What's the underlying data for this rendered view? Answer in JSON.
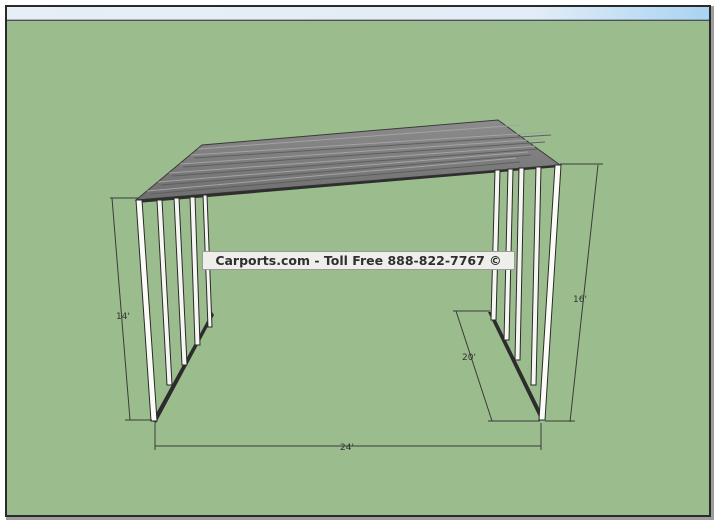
{
  "watermark": "Carports.com - Toll Free 888-822-7767 ©",
  "dimensions": {
    "height_left": "14'",
    "height_right": "16'",
    "depth": "20'",
    "width": "24'"
  },
  "colors": {
    "background": "#9bbd8e",
    "roof": "#7f7f7f",
    "frame": "#2c2c2c",
    "legs": "#fbfbf7",
    "dimension_lines": "#3a3a3a",
    "title_bar": "#dcecf8"
  }
}
